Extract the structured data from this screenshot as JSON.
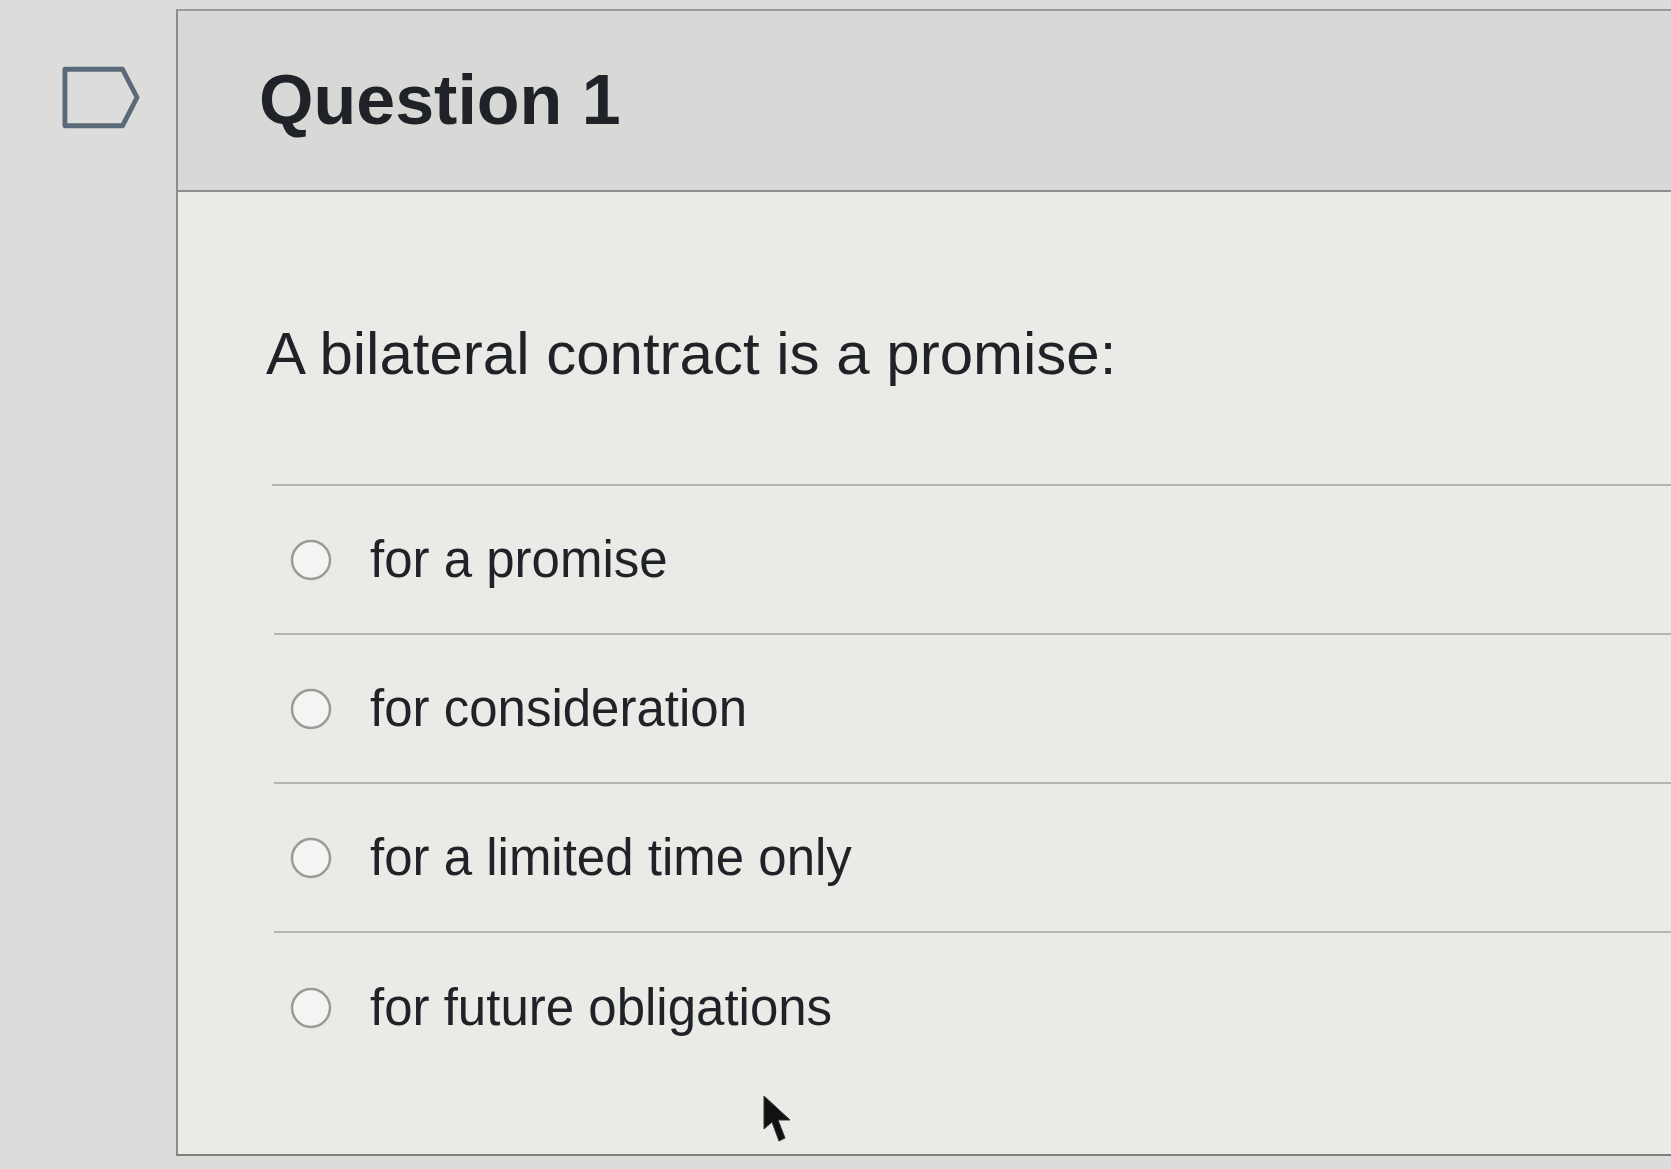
{
  "question": {
    "title": "Question 1",
    "flagged": false,
    "prompt": "A bilateral contract is a promise:",
    "options": [
      {
        "label": "for a promise",
        "selected": false
      },
      {
        "label": "for consideration",
        "selected": false
      },
      {
        "label": "for a limited time only",
        "selected": false
      },
      {
        "label": "for future obligations",
        "selected": false
      }
    ]
  }
}
